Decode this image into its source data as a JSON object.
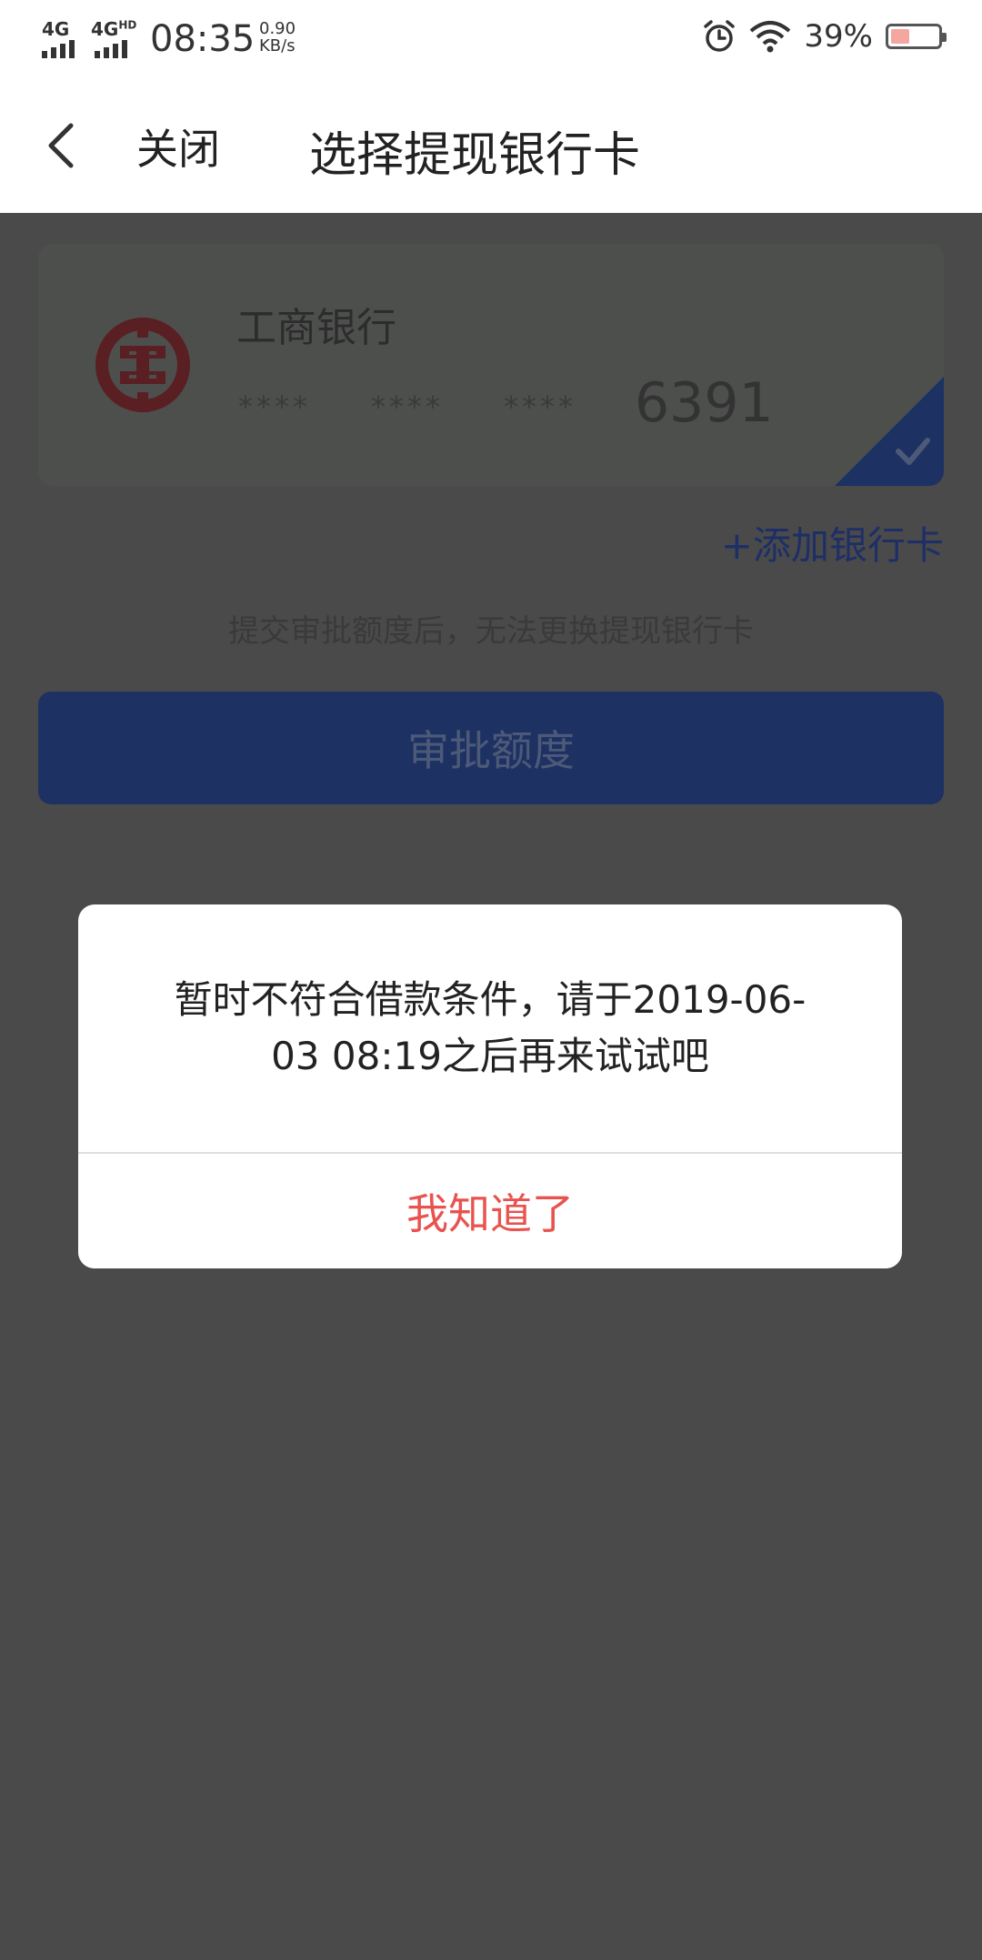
{
  "status_bar": {
    "signal1": "4G",
    "signal2": "4G",
    "signal2_sup": "HD",
    "time": "08:35",
    "net_speed": "0.90",
    "net_unit": "KB/s",
    "battery": "39%",
    "battery_level": 0.39,
    "icons": [
      "alarm-icon",
      "wifi-icon",
      "battery-icon"
    ]
  },
  "nav": {
    "back_icon": "chevron-left-icon",
    "close_label": "关闭",
    "title": "选择提现银行卡"
  },
  "card": {
    "bank_name": "工商银行",
    "mask": [
      "****",
      "****",
      "****"
    ],
    "last4": "6391",
    "selected_icon": "check-icon"
  },
  "add_card": "+添加银行卡",
  "hint": "提交审批额度后，无法更换提现银行卡",
  "approve_button": "审批额度",
  "dialog": {
    "message": "暂时不符合借款条件，请于2019-06-03 08:19之后再来试试吧",
    "button": "我知道了"
  },
  "colors": {
    "overlay": "#4a4a4a",
    "primary_blue": "#1e3163",
    "dialog_button": "#e8534f",
    "bank_red": "#c0141b"
  }
}
